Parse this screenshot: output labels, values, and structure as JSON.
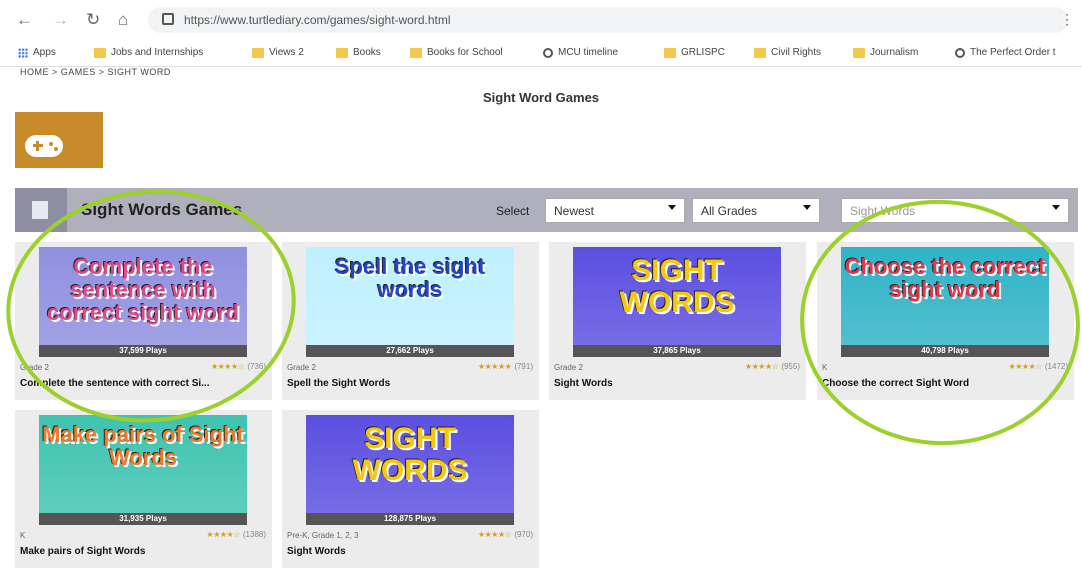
{
  "browser": {
    "url": "https://www.turtlediary.com/games/sight-word.html",
    "bookmarks": [
      "Apps",
      "Jobs and Internships",
      "Views 2",
      "Books",
      "Books for School",
      "MCU timeline",
      "GRLISPC",
      "Civil Rights",
      "Journalism",
      "The Perfect Order t"
    ]
  },
  "page": {
    "breadcrumb": "HOME > GAMES > SIGHT WORD",
    "title": "Sight Word Games"
  },
  "filterbar": {
    "title": "Sight Words Games",
    "select_label": "Select",
    "sort": "Newest",
    "grades": "All Grades",
    "category": "Sight Words"
  },
  "games": [
    {
      "thumb": "Complete the sentence with correct sight word",
      "plays": "37,599 Plays",
      "grade": "Grade 2",
      "stars": "★★★★☆",
      "reviews": "(736)",
      "name": "Complete the sentence with correct Si...",
      "bg": "#8f8fe0",
      "fg": "#d94b8a"
    },
    {
      "thumb": "Spell the sight words",
      "plays": "27,662 Plays",
      "grade": "Grade 2",
      "stars": "★★★★★",
      "reviews": "(791)",
      "name": "Spell the Sight Words",
      "bg": "#bff0ff",
      "fg": "#2346c8"
    },
    {
      "thumb": "SIGHT WORDS",
      "plays": "37,865 Plays",
      "grade": "Grade 2",
      "stars": "★★★★☆",
      "reviews": "(955)",
      "name": "Sight Words",
      "bg": "#5b4fe0",
      "fg": "#f5c710"
    },
    {
      "thumb": "Choose the correct sight word",
      "plays": "40,798 Plays",
      "grade": "K",
      "stars": "★★★★☆",
      "reviews": "(1472)",
      "name": "Choose the correct Sight Word",
      "bg": "#2fb3c6",
      "fg": "#e3384d"
    },
    {
      "thumb": "Make pairs of Sight Words",
      "plays": "31,935 Plays",
      "grade": "K",
      "stars": "★★★★☆",
      "reviews": "(1388)",
      "name": "Make pairs of Sight Words",
      "bg": "#3fc3b0",
      "fg": "#f07a2a"
    },
    {
      "thumb": "SIGHT WORDS",
      "plays": "128,875 Plays",
      "grade": "Pre-K, Grade 1, 2, 3",
      "stars": "★★★★☆",
      "reviews": "(970)",
      "name": "Sight Words",
      "bg": "#5b4fe0",
      "fg": "#f5c710"
    }
  ]
}
